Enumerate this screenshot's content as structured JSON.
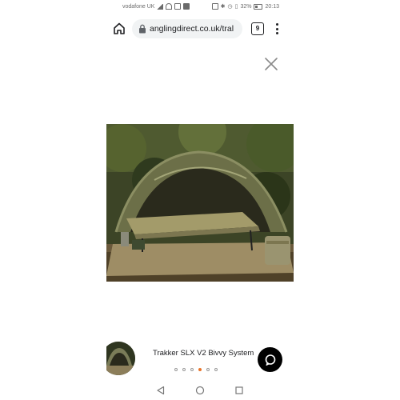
{
  "status_bar": {
    "carrier": "vodafone UK",
    "battery": "32%",
    "time": "20:13"
  },
  "browser": {
    "url": "anglingdirect.co.uk/tral",
    "tab_count": "9"
  },
  "gallery": {
    "caption": "Trakker SLX V2 Bivvy System",
    "page_count": 6,
    "active_page": 4
  },
  "icons": {
    "home": "home-icon",
    "lock": "lock-icon",
    "tabs": "tabs-icon",
    "menu": "more-vert-icon",
    "close": "close-icon",
    "chat": "chat-icon",
    "nav_back": "back-triangle-icon",
    "nav_home": "home-circle-icon",
    "nav_recent": "recent-square-icon"
  },
  "colors": {
    "accent_dot": "#e8752a",
    "chat_button": "#000000",
    "url_pill": "#f1f3f4"
  }
}
